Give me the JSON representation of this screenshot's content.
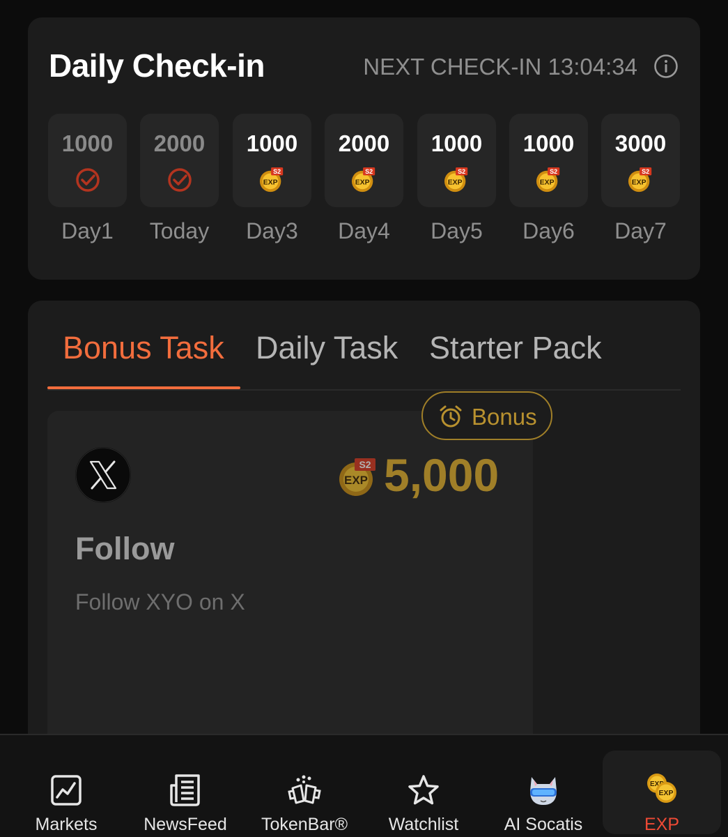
{
  "checkin": {
    "title": "Daily Check-in",
    "next_checkin": "NEXT CHECK-IN 13:04:34",
    "days": [
      {
        "label": "Day1",
        "amount": "1000",
        "status": "checked"
      },
      {
        "label": "Today",
        "amount": "2000",
        "status": "checked"
      },
      {
        "label": "Day3",
        "amount": "1000",
        "status": "pending"
      },
      {
        "label": "Day4",
        "amount": "2000",
        "status": "pending"
      },
      {
        "label": "Day5",
        "amount": "1000",
        "status": "pending"
      },
      {
        "label": "Day6",
        "amount": "1000",
        "status": "pending"
      },
      {
        "label": "Day7",
        "amount": "3000",
        "status": "pending"
      }
    ]
  },
  "tasks": {
    "tabs": [
      "Bonus Task",
      "Daily Task",
      "Starter Pack"
    ],
    "active_tab": "Bonus Task",
    "item": {
      "badge": "Bonus",
      "reward": "5,000",
      "title": "Follow",
      "description": "Follow XYO on X",
      "platform_icon": "x-logo-icon"
    }
  },
  "nav": {
    "items": [
      "Markets",
      "NewsFeed",
      "TokenBar®",
      "Watchlist",
      "AI Socatis",
      "EXP"
    ],
    "active": "EXP"
  },
  "colors": {
    "accent": "#f26d3d",
    "gold": "#a07f28",
    "check": "#b3341f",
    "active_nav": "#ef4a35"
  },
  "icons": {
    "coin": "exp-coin-icon",
    "coin_badge": "S2",
    "coin_text": "EXP"
  }
}
